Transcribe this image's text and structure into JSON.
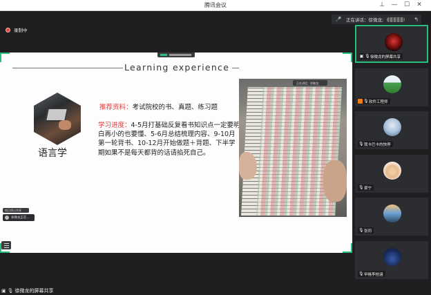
{
  "window": {
    "title": "腾讯会议",
    "controls": {
      "pin": "⊥",
      "minimize": "—",
      "maximize": "☐",
      "close": "✕"
    }
  },
  "recording": {
    "label": "录制中"
  },
  "speaking": {
    "label": "正在讲话：徐微龙;"
  },
  "slide": {
    "title": "Learning experience",
    "subject": "语言学",
    "recommend_label": "推荐资料：",
    "recommend_text": "考试院校的书、真题、练习题",
    "progress_label": "学习进度：",
    "progress_text": "4-5月打基础反复看书知识点一定要明白再小的也要懂、5-6月总结梳理内容、9-10月第一轮背书、10-12月开始做题＋背题、下半学期如果不是每天都背的话请掐死自己。",
    "photo_bar_text": "正在讲话：徐微龙;"
  },
  "floating": {
    "tip_text": "他已停止共享",
    "pill_text": "徐微龙正在..."
  },
  "participants": [
    {
      "name": "徐微龙的屏幕共享",
      "icon": "screen-share-icon",
      "active": true
    },
    {
      "name": "软件工程师",
      "icon": "host-badge-icon",
      "active": false
    },
    {
      "name": "我卡巴卡的快停",
      "icon": "user-icon",
      "active": false
    },
    {
      "name": "梁宁",
      "icon": "user-icon",
      "active": false
    },
    {
      "name": "张同",
      "icon": "user-icon",
      "active": false
    },
    {
      "name": "甲格李桂涵",
      "icon": "user-icon",
      "active": false
    }
  ],
  "bottom_bar": {
    "label": "徐微龙的屏幕共享"
  },
  "colors": {
    "accent": "#27c07c",
    "highlight_red": "#e2393a",
    "record_red": "#e8453c",
    "host_orange": "#f07b1a"
  }
}
